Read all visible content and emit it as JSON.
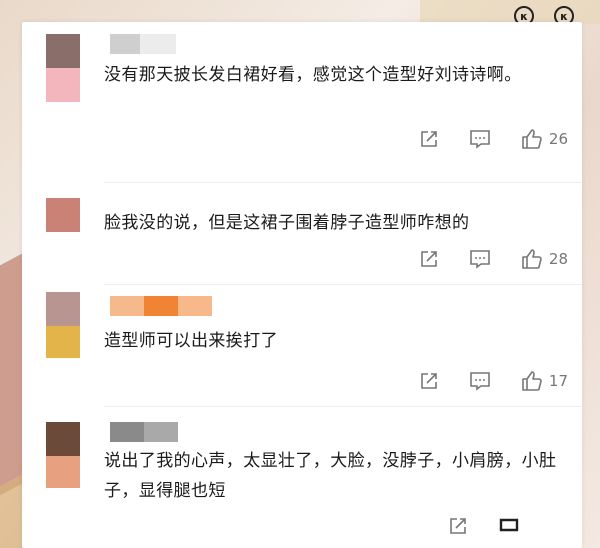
{
  "comments": [
    {
      "text": "没有那天披长发白裙好看，感觉这个造型好刘诗诗啊。",
      "likes": "26",
      "avatar_colors": [
        "#8a6e6a",
        "#f4b6bd"
      ],
      "username_colors": [
        "#cfcfcf",
        "#e9e9e9"
      ]
    },
    {
      "text": "脸我没的说，但是这裙子围着脖子造型师咋想的",
      "likes": "28",
      "avatar_colors": [
        "#c98275",
        "#c98275"
      ],
      "username_colors": []
    },
    {
      "text": "造型师可以出来挨打了",
      "likes": "17",
      "avatar_colors": [
        "#b89590",
        "#e2b44a"
      ],
      "username_colors": [
        "#f6b98c",
        "#f08334",
        "#f7b88a"
      ]
    },
    {
      "text": "说出了我的心声，太显壮了，大脸，没脖子，小肩膀，小肚子，显得腿也短",
      "likes": "",
      "avatar_colors": [
        "#6c4a3a",
        "#e7a080"
      ],
      "username_colors": [
        "#8a8a8a",
        "#a9a9a9"
      ]
    }
  ],
  "top_icons": [
    "notify-icon",
    "notify-icon"
  ],
  "icon_glyphs": {
    "top": "κ"
  }
}
